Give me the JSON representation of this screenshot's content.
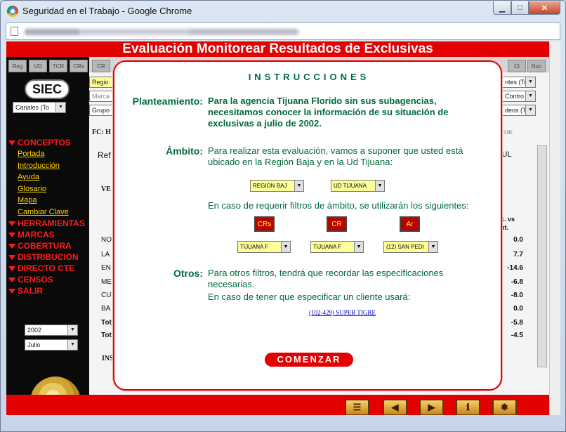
{
  "window": {
    "title": "Seguridad en el Trabajo - Google Chrome"
  },
  "header": {
    "title": "Evaluación Monitorear Resultados de Exclusivas"
  },
  "left_panel": {
    "tabs": [
      "Reg",
      "UD",
      "TCR",
      "CRs"
    ],
    "logo_text": "SIEC",
    "channel_select": "Canales (To",
    "menu": [
      {
        "label": "CONCEPTOS",
        "submenu": [
          "Portada",
          "Introducción",
          "Ayuda",
          "Glosario",
          "Mapa",
          "Cambiar Clave"
        ]
      },
      {
        "label": "HERRAMIENTAS"
      },
      {
        "label": "MARCAS"
      },
      {
        "label": "COBERTURA"
      },
      {
        "label": "DISTRIBUCION"
      },
      {
        "label": "DIRECTO CTE"
      },
      {
        "label": "CENSOS"
      },
      {
        "label": "SALIR"
      }
    ],
    "year_select": "2002",
    "month_select": "Julio"
  },
  "background": {
    "tab_cr": "CR",
    "tab_ct": "Ct",
    "tab_nuc": "Nuc",
    "sel_region": "Regio",
    "sel_marca": "Marca",
    "sel_grupo": "Grupo",
    "sel_ntes": "ntes (To",
    "sel_contro": "Contro",
    "sel_deos": "deos (To",
    "fc_label": "FC: H",
    "borrar": "orrar",
    "ref": "Ref",
    "jul": "JUL",
    "ve": "VE",
    "hdr_cvs": "c. vs",
    "hdr_ant": "nt.",
    "rows": [
      {
        "label": "NO",
        "value": "0.0"
      },
      {
        "label": "LA",
        "value": "7.7"
      },
      {
        "label": "EN",
        "value": "-14.6"
      },
      {
        "label": "ME",
        "value": "-6.8"
      },
      {
        "label": "CU",
        "value": "-8.0"
      },
      {
        "label": "BA",
        "value": "0.0"
      },
      {
        "label": "Tot",
        "value": "-5.8"
      },
      {
        "label": "Tot",
        "value": "-4.5"
      }
    ],
    "ins": "INS"
  },
  "modal": {
    "title": "INSTRUCCIONES",
    "planteamiento_label": "Planteamiento:",
    "planteamiento_text": "Para la agencia Tijuana Florido sin sus subagencias, necesitamos conocer la información de su situación de exclusivas a julio de 2002.",
    "ambito_label": "Ámbito:",
    "ambito_text": "Para realizar esta evaluación, vamos a suponer que usted está ubicado en la Región Baja y en la Ud Tijuana:",
    "region_select": "REGION BAJ",
    "ud_select": "UD TIJUANA",
    "filtros_text": "En caso de requerir filtros de ámbito, se utilizarán los siguientes:",
    "filter_buttons": [
      "CRs",
      "CR",
      "Ar"
    ],
    "filter_selects": [
      "TIJUANA F",
      "TIJUANA F",
      "(12) SAN PEDI"
    ],
    "otros_label": "Otros:",
    "otros_text": "Para otros filtros, tendrá que recordar las especificaciones necesarias.",
    "cliente_text": "En caso de tener que especificar un cliente usará:",
    "cliente_link": "(102-429) SUPER TIGRE",
    "comenzar": "COMENZAR"
  }
}
